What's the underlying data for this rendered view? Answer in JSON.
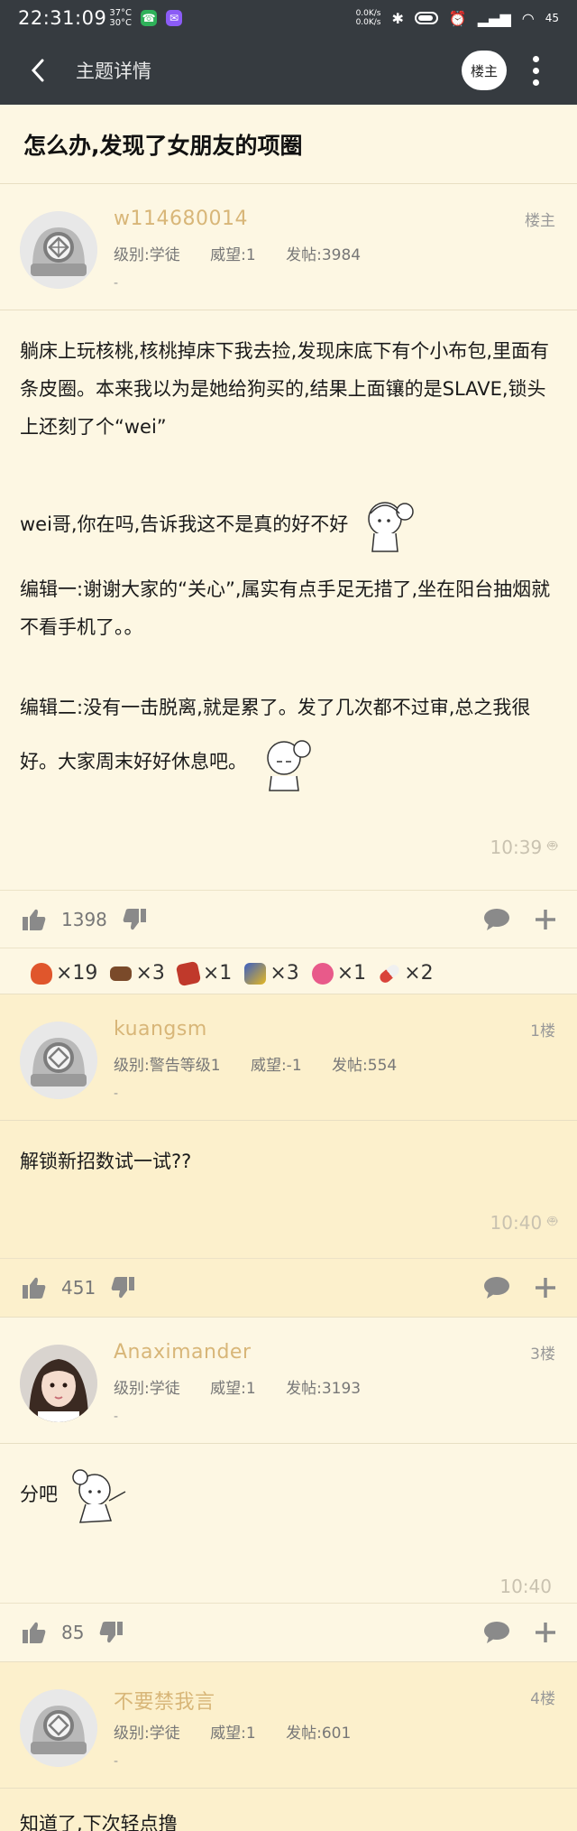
{
  "status_bar": {
    "time": "22:31:09",
    "temp_high": "37°C",
    "temp_low": "30°C",
    "net_up": "0.0K/s",
    "net_down": "0.0K/s",
    "battery_level": "45"
  },
  "topbar": {
    "title": "主题详情",
    "louzhu_label": "楼主"
  },
  "thread": {
    "title": "怎么办,发现了女朋友的项圈"
  },
  "posts": [
    {
      "username": "w114680014",
      "floor": "楼主",
      "level_label": "级别:学徒",
      "prestige_label": "威望:1",
      "posts_label": "发帖:3984",
      "signature": "-",
      "paragraphs": [
        "躺床上玩核桃,核桃掉床下我去捡,发现床底下有个小布包,里面有条皮圈。本来我以为是她给狗买的,结果上面镶的是SLAVE,锁头上还刻了个“wei”",
        "wei哥,你在吗,告诉我这不是真的好不好",
        "编辑一:谢谢大家的“关心”,属实有点手足无措了,坐在阳台抽烟就不看手机了。。",
        "编辑二:没有一击脱离,就是累了。发了几次都不过审,总之我很好。大家周末好好休息吧。"
      ],
      "time": "10:39",
      "likes": "1398",
      "gifts": [
        {
          "icon": "flame-gift-icon",
          "count": "×19",
          "color": "#e0562c"
        },
        {
          "icon": "box-gift-icon",
          "count": "×3",
          "color": "#7a4a2a"
        },
        {
          "icon": "book-gift-icon",
          "count": "×1",
          "color": "#c0392b"
        },
        {
          "icon": "dna-gift-icon",
          "count": "×3",
          "color": "#3a5fc4"
        },
        {
          "icon": "heart-gift-icon",
          "count": "×1",
          "color": "#e85a8a"
        },
        {
          "icon": "pill-gift-icon",
          "count": "×2",
          "color": "#d9433a"
        }
      ]
    },
    {
      "username": "kuangsm",
      "floor": "1楼",
      "level_label": "级别:警告等级1",
      "prestige_label": "威望:-1",
      "posts_label": "发帖:554",
      "signature": "-",
      "paragraphs": [
        "解锁新招数试一试??"
      ],
      "time": "10:40",
      "likes": "451"
    },
    {
      "username": "Anaximander",
      "floor": "3楼",
      "level_label": "级别:学徒",
      "prestige_label": "威望:1",
      "posts_label": "发帖:3193",
      "signature": "-",
      "paragraphs": [
        "分吧"
      ],
      "time": "10:40",
      "likes": "85"
    },
    {
      "username": "不要禁我言",
      "floor": "4楼",
      "level_label": "级别:学徒",
      "prestige_label": "威望:1",
      "posts_label": "发帖:601",
      "signature": "-",
      "paragraphs": [
        "知道了,下次轻点撸"
      ]
    }
  ],
  "colors": {
    "topbar_bg": "#363b40",
    "page_bg": "#fdf7e3",
    "highlight_bg": "#fcf0cc",
    "username": "#d8b678"
  }
}
